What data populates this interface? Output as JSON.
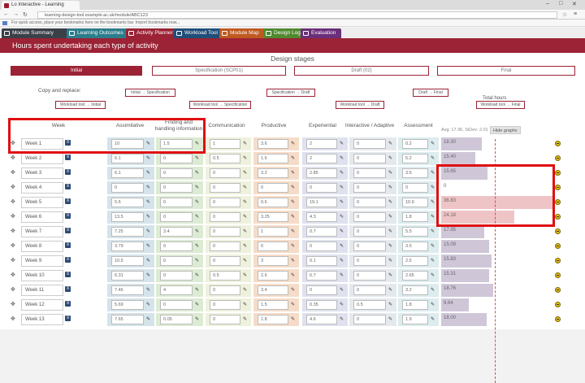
{
  "browser": {
    "tab_title": "Lo Interactive - Learning",
    "url": "learning-design-tool.example.ac.uk/module/ABC123",
    "bookmarks_hint": "For quick access, place your bookmarks here on the bookmarks bar. Import bookmarks now..."
  },
  "module_tabs": [
    {
      "label": "Module Summary",
      "color": "#3a4048"
    },
    {
      "label": "Learning Outcomes",
      "color": "#2c7d8c"
    },
    {
      "label": "Activity Planner",
      "color": "#9b2335"
    },
    {
      "label": "Workload Tool",
      "color": "#1f4e79"
    },
    {
      "label": "Module Map",
      "color": "#c05a1f"
    },
    {
      "label": "Design Log",
      "color": "#4f8a2e"
    },
    {
      "label": "Evaluation",
      "color": "#6a2f7a"
    }
  ],
  "header_title": "Hours spent undertaking each type of activity",
  "design_stages_title": "Design stages",
  "stages": [
    "Initial",
    "Specification (SCP01)",
    "Draft (02)",
    "Final"
  ],
  "copy_label": "Copy and replace:",
  "copy_buttons": {
    "init_to_spec": "Initial → Specification",
    "spec_to_draft": "Specification → Draft",
    "draft_to_final": "Draft → Final",
    "wl_init": "Workload tool → Initial",
    "wl_spec": "Workload tool → Specification",
    "wl_draft": "Workload tool → Draft",
    "wl_final": "Workload tool → Final"
  },
  "columns": [
    "Week",
    "Assimilative",
    "Finding and handling information",
    "Communication",
    "Productive",
    "Experiential",
    "Interactive / Adaptive",
    "Assessment"
  ],
  "totals_title": "Total hours",
  "totals_sub": "Avg: 17.36, SiDev: 2.01",
  "hide_graphs": "Hide graphs",
  "colors": {
    "assimilative": "#d5e3ea",
    "finding": "#dcebd3",
    "communication": "#eef1dc",
    "productive": "#f6dcc8",
    "experiential": "#dfe2ee",
    "interactive": "#e4e9ee",
    "assessment": "#dcecef",
    "accent": "#9b2335",
    "highlight": "#e01010"
  },
  "rows": [
    {
      "week": "Week 1",
      "values": [
        "10",
        "1.5",
        "1",
        "3.6",
        "2",
        "0",
        "0.2"
      ],
      "total": "18.30",
      "frac": 0.36
    },
    {
      "week": "Week 2",
      "values": [
        "6.1",
        "0",
        "0.5",
        "1.6",
        "2",
        "0",
        "5.2"
      ],
      "total": "15.40",
      "frac": 0.3
    },
    {
      "week": "Week 3",
      "values": [
        "6.1",
        "0",
        "0",
        "3.2",
        "2.85",
        "0",
        "3.5"
      ],
      "total": "15.65",
      "frac": 0.41
    },
    {
      "week": "Week 4",
      "values": [
        "0",
        "0",
        "0",
        "0",
        "0",
        "0",
        "0"
      ],
      "total": "0",
      "frac": 0
    },
    {
      "week": "Week 5",
      "values": [
        "5.6",
        "0",
        "0",
        "0.6",
        "19.1",
        "0",
        "10.9"
      ],
      "total": "36.83",
      "frac": 1.0
    },
    {
      "week": "Week 6",
      "values": [
        "13.5",
        "0",
        "0",
        "3.25",
        "4.3",
        "0",
        "1.8"
      ],
      "total": "24.18",
      "frac": 0.64
    },
    {
      "week": "Week 7",
      "values": [
        "7.25",
        "3.4",
        "0",
        "1",
        "0.7",
        "0",
        "5.5"
      ],
      "total": "17.95",
      "frac": 0.38
    },
    {
      "week": "Week 8",
      "values": [
        "3.79",
        "0",
        "0",
        "0",
        "0",
        "0",
        "3.5"
      ],
      "total": "15.09",
      "frac": 0.42
    },
    {
      "week": "Week 9",
      "values": [
        "10.5",
        "0",
        "0",
        "3",
        "0.1",
        "0",
        "2.5"
      ],
      "total": "15.83",
      "frac": 0.44
    },
    {
      "week": "Week 10",
      "values": [
        "6.31",
        "0",
        "0.5",
        "2.6",
        "6.7",
        "0",
        "2.65"
      ],
      "total": "15.31",
      "frac": 0.42
    },
    {
      "week": "Week 11",
      "values": [
        "7.46",
        "4",
        "0",
        "3.4",
        "0",
        "0",
        "3.2"
      ],
      "total": "18.76",
      "frac": 0.46
    },
    {
      "week": "Week 12",
      "values": [
        "5.69",
        "0",
        "0",
        "1.5",
        "0.35",
        "0.5",
        "1.8"
      ],
      "total": "9.64",
      "frac": 0.24
    },
    {
      "week": "Week 13",
      "values": [
        "7.65",
        "0.05",
        "0",
        "1.8",
        "4.6",
        "0",
        "1.9"
      ],
      "total": "18.00",
      "frac": 0.4
    }
  ]
}
